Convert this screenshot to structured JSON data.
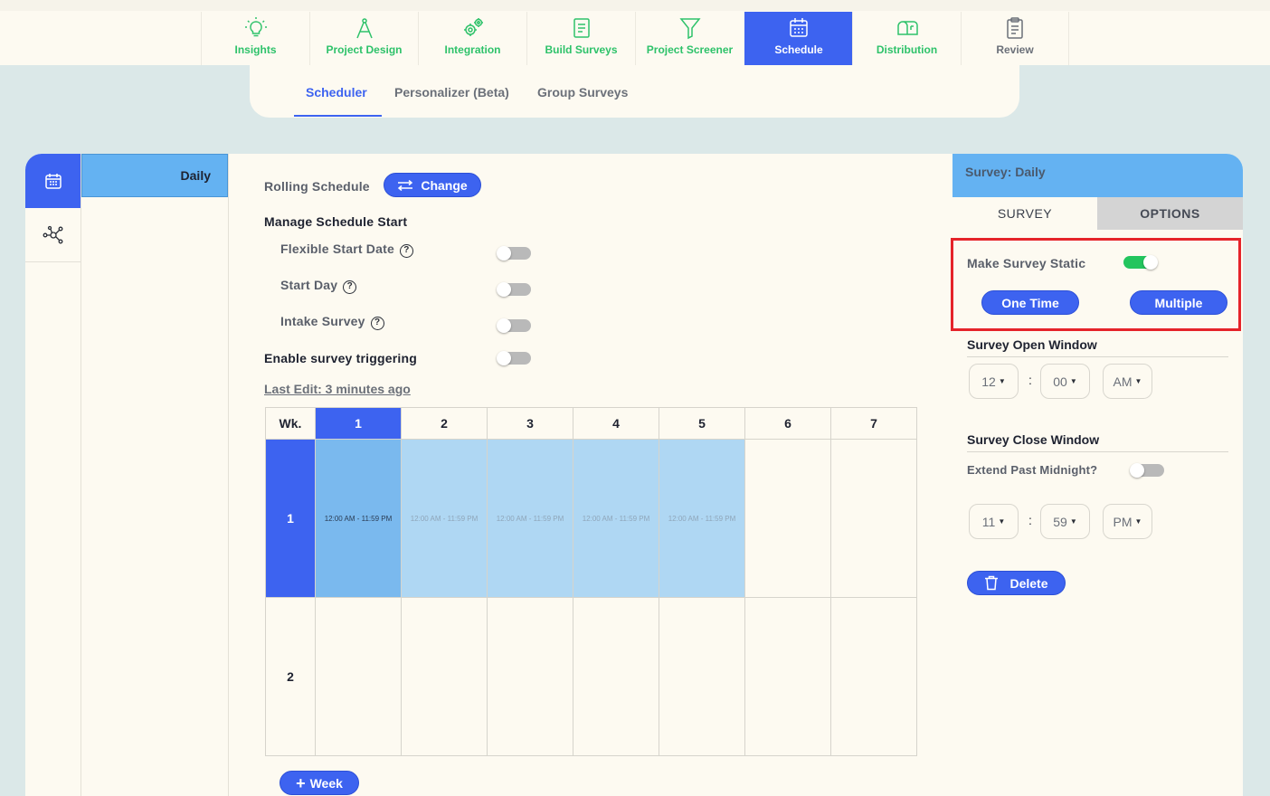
{
  "nav": {
    "items": [
      {
        "label": "Insights",
        "icon": "lightbulb-icon"
      },
      {
        "label": "Project Design",
        "icon": "compass-icon"
      },
      {
        "label": "Integration",
        "icon": "gears-icon"
      },
      {
        "label": "Build Surveys",
        "icon": "document-icon"
      },
      {
        "label": "Project Screener",
        "icon": "filter-icon"
      },
      {
        "label": "Schedule",
        "icon": "calendar-icon"
      },
      {
        "label": "Distribution",
        "icon": "mailbox-icon"
      },
      {
        "label": "Review",
        "icon": "clipboard-icon"
      }
    ],
    "active": "Schedule"
  },
  "subtabs": {
    "scheduler": "Scheduler",
    "personalizer": "Personalizer (Beta)",
    "group_surveys": "Group Surveys"
  },
  "survey_list": {
    "items": [
      "Daily"
    ]
  },
  "schedule": {
    "rolling_label": "Rolling Schedule",
    "change_button": "Change",
    "manage_start_title": "Manage Schedule Start",
    "flexible_start": "Flexible Start Date",
    "start_day": "Start Day",
    "intake_survey": "Intake Survey",
    "enable_triggering": "Enable survey triggering",
    "help_glyph": "?",
    "last_edit": "Last Edit: 3 minutes ago",
    "add_week_button": "Week",
    "add_week_plus": "+"
  },
  "grid": {
    "week_header": "Wk.",
    "days": [
      "1",
      "2",
      "3",
      "4",
      "5",
      "6",
      "7"
    ],
    "weeks": [
      "1",
      "2"
    ],
    "slot_text": "12:00 AM - 11:59 PM"
  },
  "right_panel": {
    "title": "Survey: Daily",
    "tab_survey": "SURVEY",
    "tab_options": "OPTIONS",
    "make_static": "Make Survey Static",
    "one_time": "One Time",
    "multiple": "Multiple",
    "open_window_title": "Survey Open Window",
    "open_hour": "12",
    "open_minute": "00",
    "open_ampm": "AM",
    "close_window_title": "Survey Close Window",
    "extend_midnight": "Extend Past Midnight?",
    "close_hour": "11",
    "close_minute": "59",
    "close_ampm": "PM",
    "delete_button": "Delete",
    "time_separator": ":"
  },
  "colors": {
    "accent": "#3d63f0",
    "green": "#2ec26a",
    "highlight": "#e5232a",
    "selected_blue": "#64b2f2"
  }
}
